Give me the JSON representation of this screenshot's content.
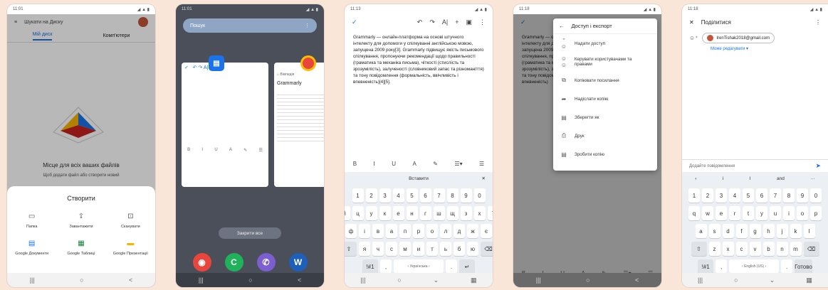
{
  "p1": {
    "time": "11:01",
    "signal": "◢ ▲ ▮",
    "menu_icon": "≡",
    "search": "Шукати на Диску",
    "tabs": [
      "Мій диск",
      "Комп'ютери"
    ],
    "empty_title": "Місце для всіх ваших файлів",
    "empty_sub": "Щоб додати файл або створити новий",
    "sheet_title": "Створити",
    "create_items": [
      {
        "icon": "folder-icon",
        "glyph": "▭",
        "label": "Папка",
        "color": "#555555"
      },
      {
        "icon": "upload-icon",
        "glyph": "⇪",
        "label": "Завантажити",
        "color": "#555555"
      },
      {
        "icon": "scan-icon",
        "glyph": "⊡",
        "label": "Сканувати",
        "color": "#555555"
      },
      {
        "icon": "google-docs-icon",
        "glyph": "▤",
        "label": "Google Документи",
        "color": "#1a73e8"
      },
      {
        "icon": "google-sheets-icon",
        "glyph": "▦",
        "label": "Google Таблиці",
        "color": "#188038"
      },
      {
        "icon": "google-slides-icon",
        "glyph": "▬",
        "label": "Google Презентації",
        "color": "#f4b400"
      }
    ],
    "nav": [
      "|||",
      "○",
      "<"
    ]
  },
  "p2": {
    "time": "11:01",
    "search": "Пошук",
    "card2_url": "⌂ Вікіпедія",
    "card2_title": "Grammarly",
    "close_all": "Закрити все",
    "dock": [
      {
        "icon": "chrome-icon",
        "glyph": "◉",
        "color": "#e8453c"
      },
      {
        "icon": "phone-app-icon",
        "glyph": "C",
        "color": "#20b25a"
      },
      {
        "icon": "viber-icon",
        "glyph": "✆",
        "color": "#7b5ecf"
      },
      {
        "icon": "word-icon",
        "glyph": "W",
        "color": "#1e5fba"
      }
    ],
    "nav": [
      "|||",
      "○",
      "<"
    ]
  },
  "p3": {
    "time": "11:13",
    "check": "✓",
    "tools": [
      "↶",
      "↷",
      "A|",
      "+",
      "▣",
      "⋮"
    ],
    "doc_text": "Grammarly — онлайн-платформа на основі штучного інтелекту для допомоги у спілкуванні англійською мовою, запущена 2009 року[3]. Grammarly підвищує якість письмового спілкування, пропонуючи рекомендації щодо правильності (граматика та механіка письма), чіткості (стислість та зрозумілість), залученості (словниковий запас та різноманіття) та тону повідомлення (формальність, ввічливість і впевненість)[4][5].",
    "fmt": [
      "B",
      "I",
      "U",
      "A",
      "✎",
      "☰▾",
      "☰"
    ],
    "suggestion": "Вставити",
    "close_kb": "✕",
    "rows": [
      [
        "1",
        "2",
        "3",
        "4",
        "5",
        "6",
        "7",
        "8",
        "9",
        "0"
      ],
      [
        "й",
        "ц",
        "у",
        "к",
        "е",
        "н",
        "г",
        "ш",
        "щ",
        "з",
        "х",
        "ї"
      ],
      [
        "ф",
        "і",
        "в",
        "а",
        "п",
        "р",
        "о",
        "л",
        "д",
        "ж",
        "є"
      ],
      [
        "⇧",
        "я",
        "ч",
        "с",
        "м",
        "и",
        "т",
        "ь",
        "б",
        "ю",
        "⌫"
      ],
      [
        "!#1",
        ",",
        "‹ Українська ›",
        ".",
        "↵"
      ]
    ],
    "nav": [
      "|||",
      "○",
      "⌄",
      "▦"
    ]
  },
  "p4": {
    "time": "11:18",
    "bg_text": "Grammarly — онлайн-платформа на основі штучного інтелекту для допомоги у спілкуванні англійською мовою, запущена 2009 року. Grammarly підвищує якість письмового спілкування, пропонуючи рекомендації щодо правильності (граматика та механіка письма), чіткості (стислість та зрозумілість), залученості (словниковий запас та різноманіття) та тону повідомлення (формальність, ввічливість і впевненість)",
    "menu_title": "Доступ і експорт",
    "items": [
      {
        "icon": "add-person-icon",
        "glyph": "⁺☺",
        "label": "Надати доступ"
      },
      {
        "icon": "manage-people-icon",
        "glyph": "☺☺",
        "label": "Керувати користувачами та правами"
      },
      {
        "icon": "copy-link-icon",
        "glyph": "⧉",
        "label": "Копіювати посилання"
      },
      {
        "icon": "send-copy-icon",
        "glyph": "➦",
        "label": "Надіслати копію"
      },
      {
        "icon": "save-as-icon",
        "glyph": "▤",
        "label": "Зберегти як"
      },
      {
        "icon": "print-icon",
        "glyph": "⎙",
        "label": "Друк"
      },
      {
        "icon": "make-copy-icon",
        "glyph": "▤",
        "label": "Зробити копію"
      }
    ],
    "fmt": [
      "B",
      "I",
      "U",
      "A",
      "✎",
      "☰▾",
      "☰"
    ],
    "nav": [
      "|||",
      "○",
      "<"
    ]
  },
  "p5": {
    "time": "11:18",
    "close": "✕",
    "title": "Поділитися",
    "more": "⋮",
    "email": "IrenTishak2018@gmail.com",
    "role": "Може редагувати ▾",
    "message_placeholder": "Додайте повідомлення",
    "send": "➤",
    "sugg": [
      "‹",
      "і",
      "І",
      "and",
      "···"
    ],
    "rows": [
      [
        "1",
        "2",
        "3",
        "4",
        "5",
        "6",
        "7",
        "8",
        "9",
        "0"
      ],
      [
        "q",
        "w",
        "e",
        "r",
        "t",
        "y",
        "u",
        "i",
        "o",
        "p"
      ],
      [
        "a",
        "s",
        "d",
        "f",
        "g",
        "h",
        "j",
        "k",
        "l"
      ],
      [
        "⇧",
        "z",
        "x",
        "c",
        "v",
        "b",
        "n",
        "m",
        "⌫"
      ],
      [
        "!#1",
        ",",
        "‹ English (US) ›",
        ".",
        "Готово"
      ]
    ],
    "nav": [
      "|||",
      "○",
      "⌄",
      "▦"
    ]
  }
}
